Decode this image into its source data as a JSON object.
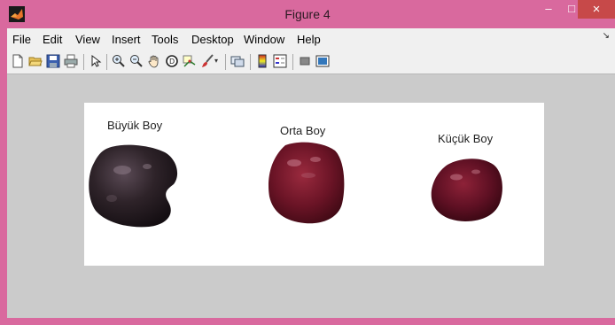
{
  "window": {
    "title": "Figure 4",
    "close_glyph": "×",
    "minimize_glyph": "–",
    "maximize_glyph": "□"
  },
  "menu": {
    "items": [
      "File",
      "Edit",
      "View",
      "Insert",
      "Tools",
      "Desktop",
      "Window",
      "Help"
    ],
    "overflow_glyph": "↘"
  },
  "figure": {
    "labels": {
      "large": "Büyük Boy",
      "medium": "Orta Boy",
      "small": "Küçük Boy"
    }
  },
  "colors": {
    "titlebar": "#d9699e",
    "close_button": "#c74949",
    "figure_background": "#cbcbcb",
    "axes_background": "#ffffff",
    "cherry_large": "#2a1f26",
    "cherry_medium": "#6b1426",
    "cherry_small": "#5e1023"
  },
  "icons": [
    "new-figure-icon",
    "open-file-icon",
    "save-icon",
    "print-icon",
    "select-arrow-icon",
    "zoom-in-icon",
    "zoom-out-icon",
    "pan-hand-icon",
    "rotate-3d-icon",
    "data-cursor-icon",
    "brush-icon",
    "link-plot-icon",
    "colorbar-icon",
    "legend-icon",
    "hide-plot-tools-icon",
    "show-plot-tools-icon"
  ]
}
